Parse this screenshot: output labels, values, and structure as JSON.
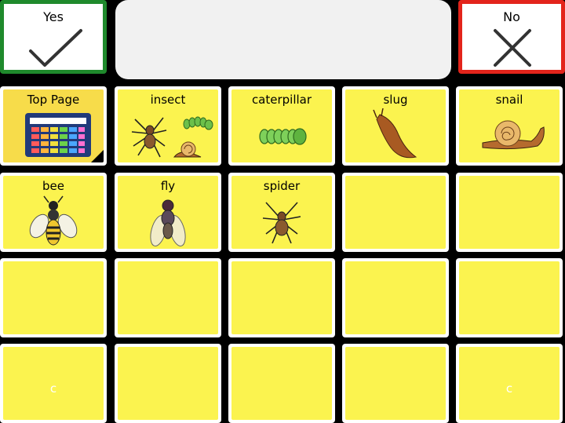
{
  "yes_button": {
    "label": "Yes",
    "icon": "checkmark-icon",
    "border_color": "#1f8a2c"
  },
  "no_button": {
    "label": "No",
    "icon": "cross-icon",
    "border_color": "#e3241b"
  },
  "message_bar": {
    "text": ""
  },
  "tile_color": "#fbf34f",
  "tiles": [
    {
      "label": "Top Page",
      "icon": "grid-page-icon"
    },
    {
      "label": "insect",
      "icon": "insect-icon"
    },
    {
      "label": "caterpillar",
      "icon": "caterpillar-icon"
    },
    {
      "label": "slug",
      "icon": "slug-icon"
    },
    {
      "label": "snail",
      "icon": "snail-icon"
    },
    {
      "label": "bee",
      "icon": "bee-icon"
    },
    {
      "label": "fly",
      "icon": "fly-icon"
    },
    {
      "label": "spider",
      "icon": "spider-icon"
    },
    {
      "label": ""
    },
    {
      "label": ""
    },
    {
      "label": ""
    },
    {
      "label": ""
    },
    {
      "label": ""
    },
    {
      "label": ""
    },
    {
      "label": ""
    },
    {
      "label": "c"
    },
    {
      "label": ""
    },
    {
      "label": ""
    },
    {
      "label": ""
    },
    {
      "label": "c"
    }
  ]
}
